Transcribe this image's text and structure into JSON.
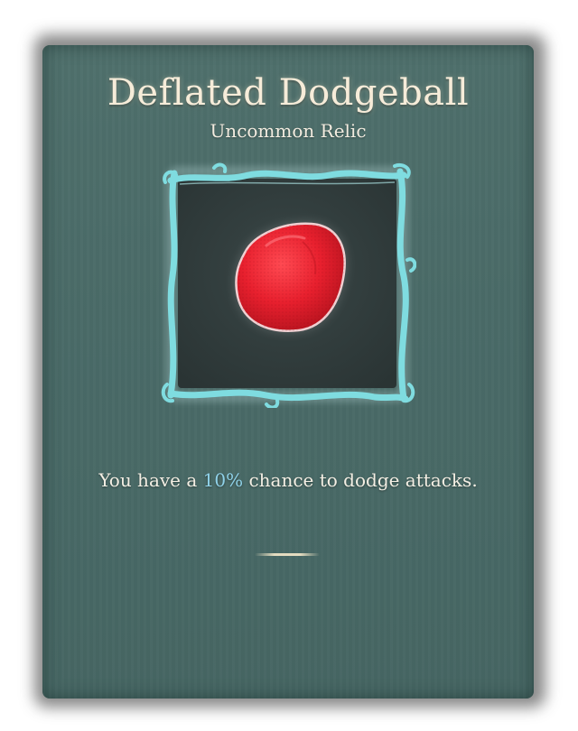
{
  "relic": {
    "name": "Deflated Dodgeball",
    "rarity": "Uncommon Relic",
    "icon": "deflated-dodgeball-icon",
    "description": {
      "prefix": "You have a ",
      "value": "10%",
      "suffix": " chance to dodge attacks."
    }
  },
  "colors": {
    "card_background": "#4a6b68",
    "frame_glow": "#7fdce0",
    "icon_panel": "#2f3b3b",
    "ball": "#e8202e",
    "highlight": "#8fd1e8",
    "title": "#f6ecd9"
  }
}
